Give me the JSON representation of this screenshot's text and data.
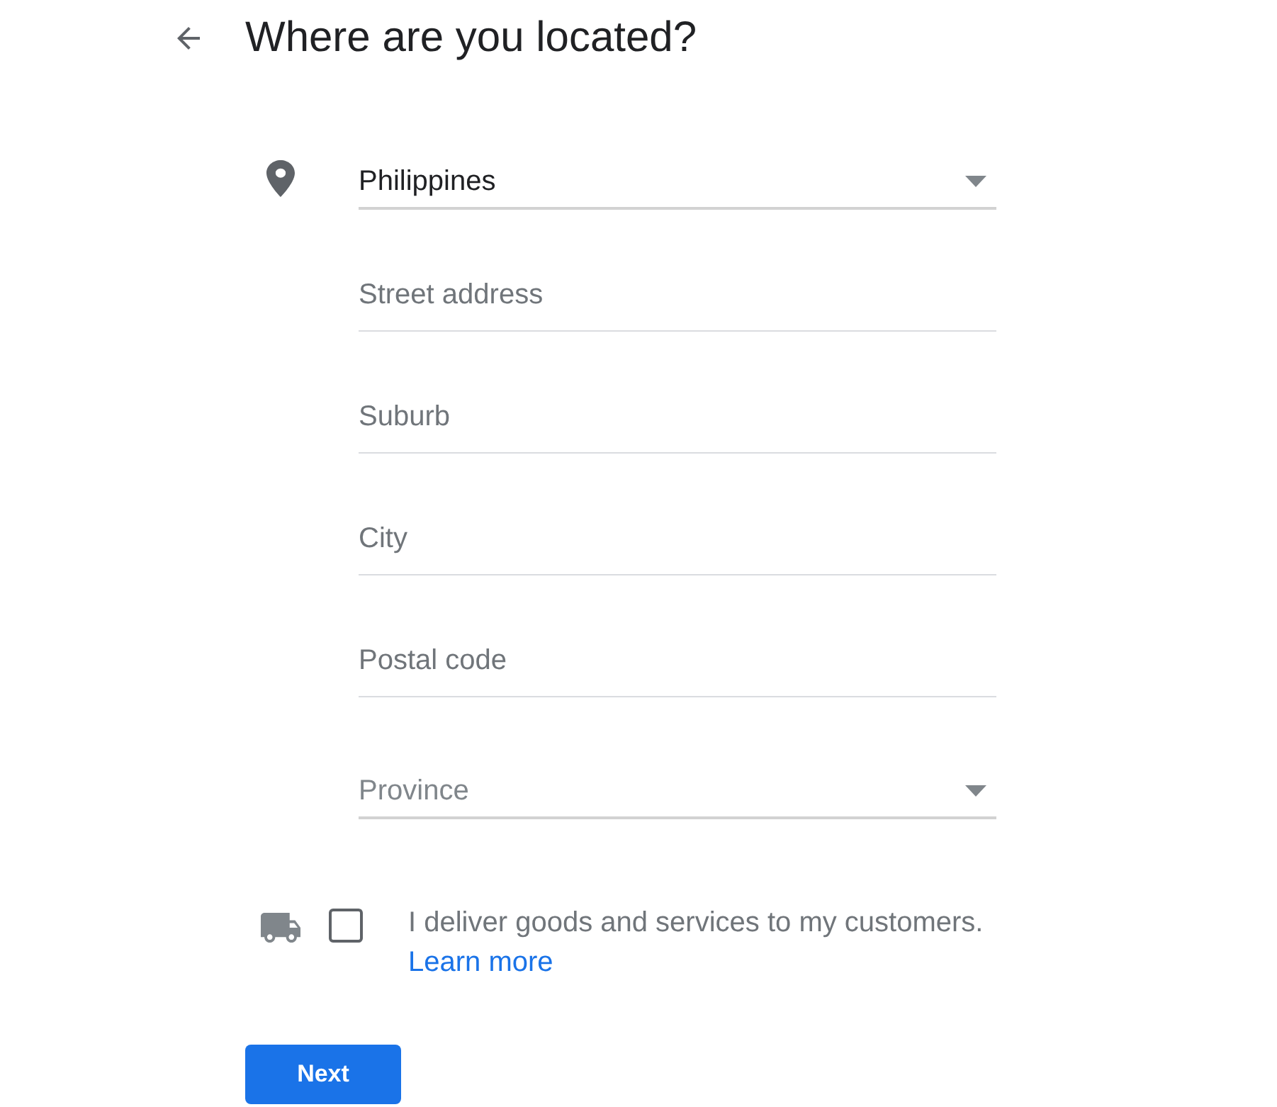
{
  "header": {
    "title": "Where are you located?"
  },
  "fields": [
    {
      "kind": "select",
      "value": "Philippines"
    },
    {
      "kind": "text",
      "placeholder": "Street address"
    },
    {
      "kind": "text",
      "placeholder": "Suburb"
    },
    {
      "kind": "text",
      "placeholder": "City"
    },
    {
      "kind": "text",
      "placeholder": "Postal code"
    },
    {
      "kind": "select",
      "placeholder": "Province"
    }
  ],
  "delivery": {
    "checked": false,
    "label": "I deliver goods and services to my customers.",
    "link": "Learn more"
  },
  "buttons": [
    {
      "label": "Next"
    }
  ]
}
